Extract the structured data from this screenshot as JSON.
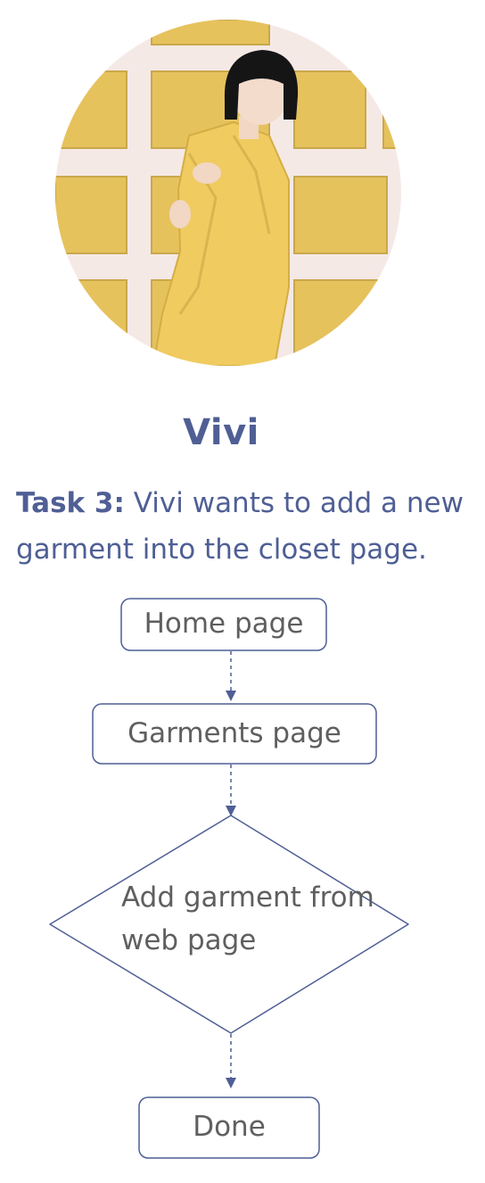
{
  "persona": {
    "name": "Vivi",
    "photo": "portrait of woman in yellow suit against yellow paneled wall"
  },
  "task": {
    "label": "Task 3:",
    "description": " Vivi wants to add a new garment into the closet page."
  },
  "flowchart": {
    "nodes": [
      {
        "id": "home",
        "label": "Home page",
        "shape": "rounded-rect"
      },
      {
        "id": "garments",
        "label": "Garments page",
        "shape": "rounded-rect"
      },
      {
        "id": "add",
        "label": "Add garment from web page",
        "shape": "diamond"
      },
      {
        "id": "done",
        "label": "Done",
        "shape": "rounded-rect"
      }
    ],
    "edges": [
      {
        "from": "home",
        "to": "garments",
        "style": "dashed-arrow"
      },
      {
        "from": "garments",
        "to": "add",
        "style": "dashed-arrow"
      },
      {
        "from": "add",
        "to": "done",
        "style": "dashed-arrow"
      }
    ]
  },
  "colors": {
    "accent": "#4f5f95",
    "node_text": "#5f5f5f",
    "wall_yellow": "#e8c866",
    "wall_trim": "#f5e9e6",
    "suit_yellow": "#f0cb60"
  }
}
